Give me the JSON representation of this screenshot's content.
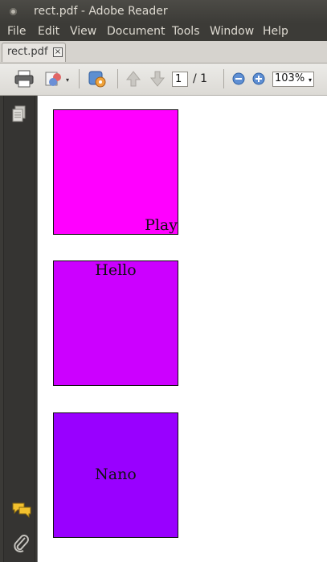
{
  "window": {
    "title": "rect.pdf - Adobe Reader"
  },
  "menu": {
    "items": [
      "File",
      "Edit",
      "View",
      "Document",
      "Tools",
      "Window",
      "Help"
    ]
  },
  "tabs": [
    {
      "label": "rect.pdf",
      "close": "×"
    }
  ],
  "toolbar": {
    "icons": [
      "printer-icon",
      "share-icon",
      "settings-icon",
      "prev-page-icon",
      "next-page-icon",
      "zoom-out-icon",
      "zoom-in-icon"
    ],
    "page_current": "1",
    "page_total": "/ 1",
    "zoom": "103%",
    "dropdown_glyph": "▾"
  },
  "sidebar": {
    "icons": [
      "pages-icon",
      "comments-icon",
      "attachment-icon"
    ]
  },
  "document": {
    "rectangles": [
      {
        "label": "Play",
        "color": "#ff00ff"
      },
      {
        "label": "Hello",
        "color": "#cc00ff"
      },
      {
        "label": "Nano",
        "color": "#9900ff"
      }
    ]
  }
}
